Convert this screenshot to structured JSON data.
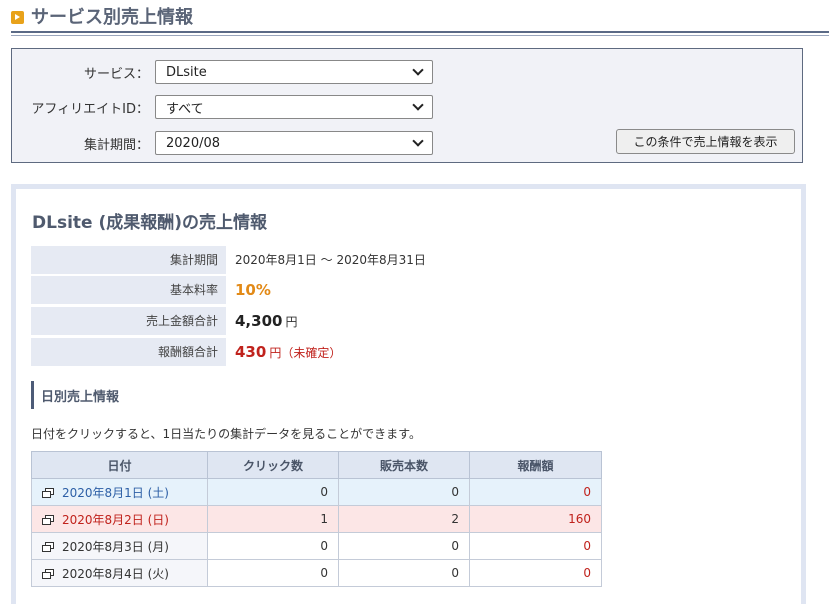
{
  "page": {
    "title": "サービス別売上情報"
  },
  "filter": {
    "service_label": "サービス：",
    "service_value": "DLsite",
    "affiliate_label": "アフィリエイトID：",
    "affiliate_value": "すべて",
    "period_label": "集計期間：",
    "period_value": "2020/08",
    "submit_label": "この条件で売上情報を表示"
  },
  "result": {
    "heading": "DLsite (成果報酬)の売上情報",
    "summary": {
      "period_label": "集計期間",
      "period_value": "2020年8月1日 〜 2020年8月31日",
      "rate_label": "基本料率",
      "rate_value": "10%",
      "sales_label": "売上金額合計",
      "sales_value": "4,300",
      "sales_unit": "円",
      "reward_label": "報酬額合計",
      "reward_value": "430",
      "reward_unit": "円（未確定）"
    },
    "daily_heading": "日別売上情報",
    "daily_note": "日付をクリックすると、1日当たりの集計データを見ることができます。",
    "columns": [
      "日付",
      "クリック数",
      "販売本数",
      "報酬額"
    ],
    "rows": [
      {
        "date": "2020年8月1日 (土)",
        "clicks": "0",
        "sales": "0",
        "reward": "0",
        "type": "sat"
      },
      {
        "date": "2020年8月2日 (日)",
        "clicks": "1",
        "sales": "2",
        "reward": "160",
        "type": "sun"
      },
      {
        "date": "2020年8月3日 (月)",
        "clicks": "0",
        "sales": "0",
        "reward": "0",
        "type": "wk"
      },
      {
        "date": "2020年8月4日 (火)",
        "clicks": "0",
        "sales": "0",
        "reward": "0",
        "type": "wk"
      }
    ]
  },
  "colors": {
    "accent": "#e8a21a",
    "heading": "#4f5a6e",
    "red": "#c0221c",
    "orange": "#e28a18",
    "link": "#2d5fa6"
  }
}
